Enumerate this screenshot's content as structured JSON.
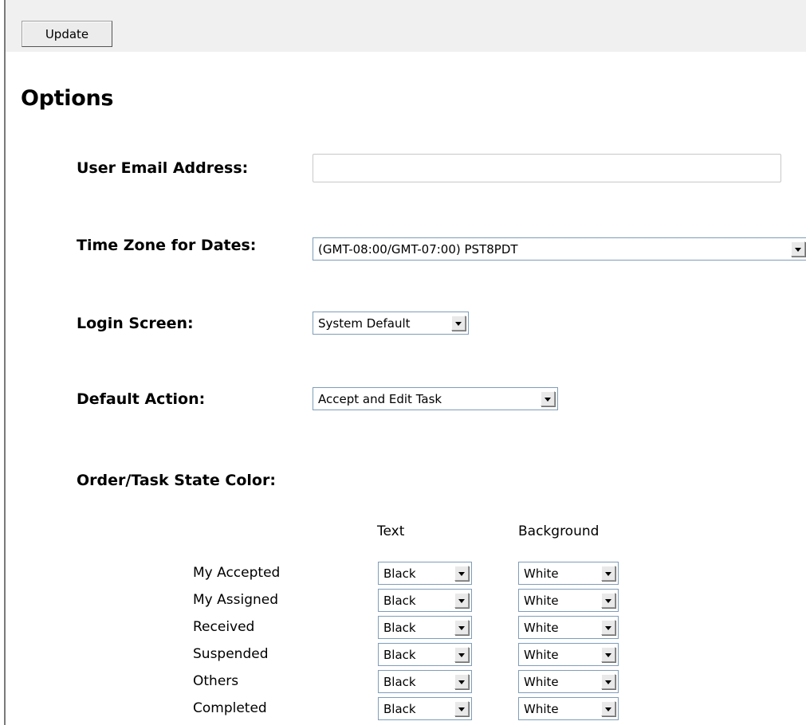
{
  "toolbar": {
    "update_label": "Update"
  },
  "page": {
    "title": "Options"
  },
  "fields": {
    "email": {
      "label": "User Email Address:",
      "value": "",
      "placeholder": ""
    },
    "timezone": {
      "label": "Time Zone for Dates:",
      "value": "(GMT-08:00/GMT-07:00) PST8PDT"
    },
    "login_screen": {
      "label": "Login Screen:",
      "value": "System Default"
    },
    "default_action": {
      "label": "Default Action:",
      "value": "Accept and Edit Task"
    },
    "state_color": {
      "label": "Order/Task State Color:"
    }
  },
  "state_colors": {
    "headers": {
      "text": "Text",
      "background": "Background"
    },
    "rows": [
      {
        "label": "My Accepted",
        "text": "Black",
        "background": "White"
      },
      {
        "label": "My Assigned",
        "text": "Black",
        "background": "White"
      },
      {
        "label": "Received",
        "text": "Black",
        "background": "White"
      },
      {
        "label": "Suspended",
        "text": "Black",
        "background": "White"
      },
      {
        "label": "Others",
        "text": "Black",
        "background": "White"
      },
      {
        "label": "Completed",
        "text": "Black",
        "background": "White"
      }
    ]
  },
  "icons": {
    "dropdown": "chevron-down-icon"
  }
}
